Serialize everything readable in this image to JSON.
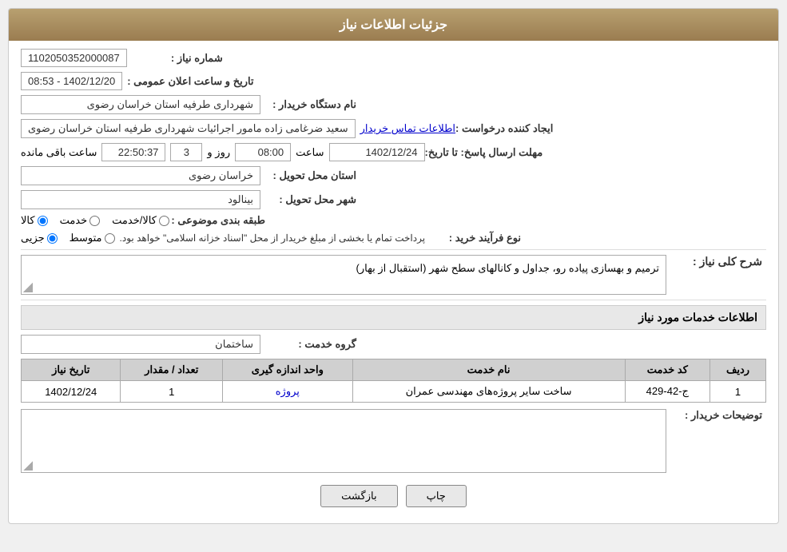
{
  "page": {
    "title": "جزئیات اطلاعات نیاز",
    "header": {
      "label": "جزئیات اطلاعات نیاز"
    }
  },
  "fields": {
    "request_number_label": "شماره نیاز :",
    "request_number_value": "1102050352000087",
    "buyer_org_label": "نام دستگاه خریدار :",
    "buyer_org_value": "شهرداری طرفیه استان خراسان رضوی",
    "requester_label": "ایجاد کننده درخواست :",
    "requester_value": "سعید ضرغامی زاده مامور اجرائیات شهرداری طرفیه استان خراسان رضوی",
    "requester_link": "اطلاعات تماس خریدار",
    "announce_datetime_label": "تاریخ و ساعت اعلان عمومی :",
    "announce_datetime_value": "1402/12/20 - 08:53",
    "deadline_label": "مهلت ارسال پاسخ: تا تاریخ:",
    "deadline_date": "1402/12/24",
    "deadline_time_label": "ساعت",
    "deadline_time": "08:00",
    "deadline_days_label": "روز و",
    "deadline_days": "3",
    "deadline_remaining_label": "ساعت باقی مانده",
    "deadline_remaining": "22:50:37",
    "province_label": "استان محل تحویل :",
    "province_value": "خراسان رضوی",
    "city_label": "شهر محل تحویل :",
    "city_value": "بینالود",
    "category_label": "طبقه بندی موضوعی :",
    "category_options": [
      "کالا",
      "خدمت",
      "کالا/خدمت"
    ],
    "category_selected": "کالا",
    "procurement_label": "نوع فرآیند خرید :",
    "procurement_options": [
      "جزیی",
      "متوسط"
    ],
    "procurement_note": "پرداخت تمام یا بخشی از مبلغ خریدار از محل \"اسناد خزانه اسلامی\" خواهد بود.",
    "description_label": "شرح کلی نیاز :",
    "description_value": "ترمیم و بهسازی پیاده رو، جداول و کانالهای سطح شهر (استقبال از بهار)",
    "service_info_label": "اطلاعات خدمات مورد نیاز",
    "service_group_label": "گروه خدمت :",
    "service_group_value": "ساختمان",
    "table": {
      "headers": [
        "ردیف",
        "کد خدمت",
        "نام خدمت",
        "واحد اندازه گیری",
        "تعداد / مقدار",
        "تاریخ نیاز"
      ],
      "rows": [
        {
          "row": "1",
          "code": "ج-42-429",
          "name": "ساخت سایر پروژه‌های مهندسی عمران",
          "unit": "پروژه",
          "quantity": "1",
          "date": "1402/12/24"
        }
      ]
    },
    "buyer_notes_label": "توضیحات خریدار :",
    "buyer_notes_value": "",
    "btn_print": "چاپ",
    "btn_back": "بازگشت"
  }
}
